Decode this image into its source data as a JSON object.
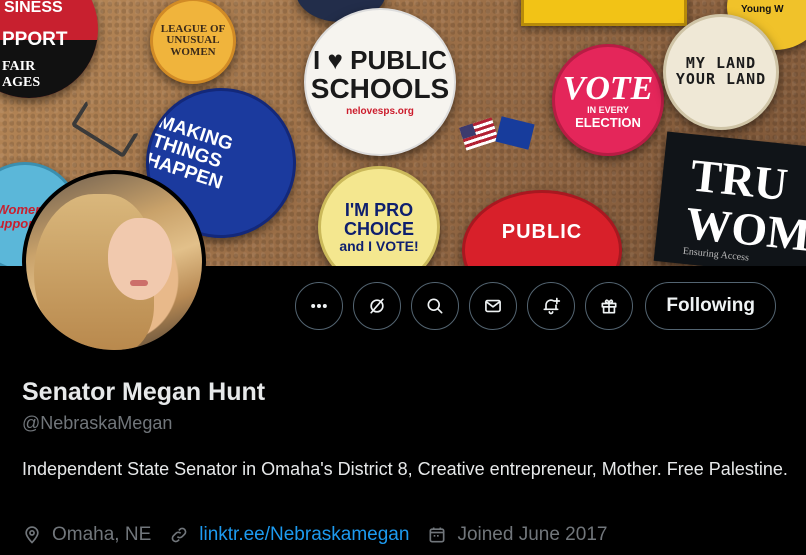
{
  "banner": {
    "pins": {
      "business_line1": "SINESS",
      "business_line2": "PPORT",
      "business_line3": "FAIR",
      "business_line4": "AGES",
      "league": "LEAGUE OF UNUSUAL WOMEN",
      "public_line1": "I ♥ PUBLIC",
      "public_line2": "SCHOOLS",
      "public_url": "nelovesps.org",
      "young": "Young W",
      "vote_line1": "VOTE",
      "vote_line2": "IN EVERY",
      "vote_line3": "ELECTION",
      "land": "MY LAND YOUR LAND",
      "math": "MAKING THINGS HAPPEN",
      "choice_line1": "I'M PRO CHOICE",
      "choice_line2": "and I VOTE!",
      "public2": "PUBLIC",
      "true_line1": "TRU",
      "true_line2": "WOM",
      "true_line3": "Ensuring Access",
      "left2": "Women's support mu"
    }
  },
  "profile": {
    "name": "Senator Megan Hunt",
    "handle": "@NebraskaMegan",
    "bio": "Independent State Senator in Omaha's District 8, Creative entrepreneur, Mother. Free Palestine.",
    "location": "Omaha, NE",
    "link": "linktr.ee/Nebraskamegan",
    "joined": "Joined June 2017"
  },
  "actions": {
    "follow_label": "Following",
    "icons": [
      "more-icon",
      "grok-icon",
      "search-icon",
      "message-icon",
      "notification-add-icon",
      "gift-icon"
    ]
  },
  "colors": {
    "background": "#000000",
    "text": "#e7e9ea",
    "muted": "#71767b",
    "link": "#1d9bf0",
    "border": "#536471"
  }
}
